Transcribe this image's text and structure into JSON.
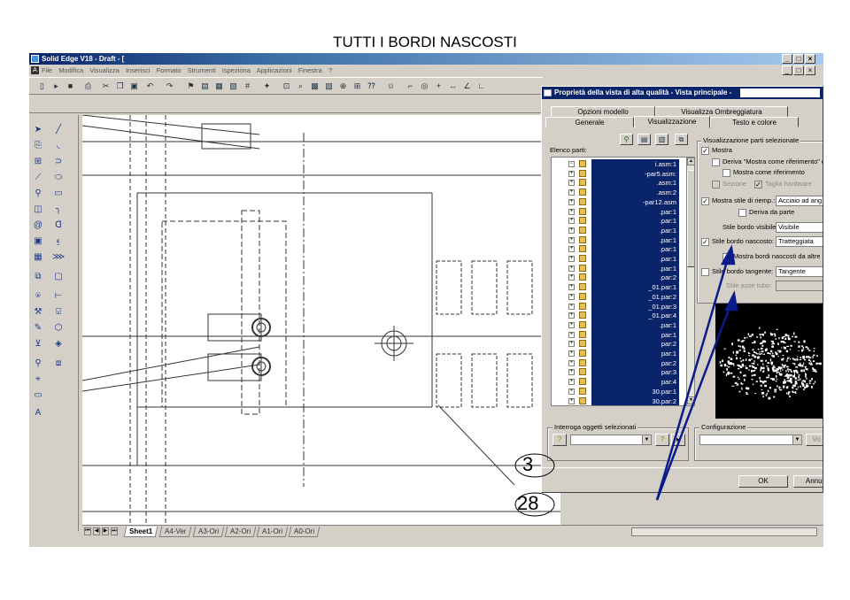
{
  "caption": "TUTTI I BORDI NASCOSTI",
  "app": {
    "title": "Solid Edge V18 - Draft - [",
    "menu": [
      "File",
      "Modifica",
      "Visualizza",
      "Inserisci",
      "Formato",
      "Strumenti",
      "Ispeziona",
      "Applicazioni",
      "Finestra",
      "?"
    ],
    "window_controls": [
      "_",
      "□",
      "×"
    ]
  },
  "sheets": [
    "Sheet1",
    "A4-Ver",
    "A3-Ori",
    "A2-Ori",
    "A1-Ori",
    "A0-Ori"
  ],
  "dialog": {
    "title": "Proprietà della vista di alta qualità - Vista principale -",
    "tabs_top": [
      "Opzioni modello",
      "Visualizza Ombreggiatura"
    ],
    "tabs_bottom": [
      "Generale",
      "Visualizzazione",
      "Testo e colore"
    ],
    "active_tab": "Visualizzazione",
    "parts_label": "Elenco parti:",
    "tree": [
      {
        "sign": "−",
        "name": "i.asm:1"
      },
      {
        "sign": "+",
        "name": "-par5.asm:"
      },
      {
        "sign": "+",
        "name": ".asm:1"
      },
      {
        "sign": "+",
        "name": ".asm:2"
      },
      {
        "sign": "+",
        "name": "-par12.asm"
      },
      {
        "sign": "+",
        "name": ".par:1"
      },
      {
        "sign": "+",
        "name": ".par:1"
      },
      {
        "sign": "+",
        "name": ".par:1"
      },
      {
        "sign": "+",
        "name": ".par:1"
      },
      {
        "sign": "+",
        "name": ".par:1"
      },
      {
        "sign": "+",
        "name": ".par:1"
      },
      {
        "sign": "+",
        "name": ".par:1"
      },
      {
        "sign": "+",
        "name": ".par:2"
      },
      {
        "sign": "+",
        "name": "_01.par:1"
      },
      {
        "sign": "+",
        "name": "_01.par:2"
      },
      {
        "sign": "+",
        "name": "_01.par:3"
      },
      {
        "sign": "+",
        "name": "_01.par:4"
      },
      {
        "sign": "+",
        "name": ".par:1"
      },
      {
        "sign": "+",
        "name": "par:1"
      },
      {
        "sign": "+",
        "name": "par:2"
      },
      {
        "sign": "+",
        "name": "par:1"
      },
      {
        "sign": "+",
        "name": "par:2"
      },
      {
        "sign": "+",
        "name": "par:3"
      },
      {
        "sign": "+",
        "name": "par:4"
      },
      {
        "sign": "+",
        "name": "30.par:1"
      },
      {
        "sign": "+",
        "name": "30.par:2"
      }
    ],
    "group_title": "Visualizzazione parti selezionate",
    "mostra": "Mostra",
    "deriva_riferimento": "Deriva \"Mostra come riferimento\" d",
    "mostra_come_riferimento": "Mostra come riferimento",
    "sezione": "Sezione",
    "taglia_hardware": "Taglia hardware",
    "mostra_stile_riemp": "Mostra stile di riemp.:",
    "stile_riemp_value": "Acciaio ad ang",
    "deriva_da_parte": "Deriva da parte",
    "stile_bordo_visibile": "Stile bordo visibile:",
    "stile_bordo_visibile_value": "Visibile",
    "stile_bordo_nascosto": "Stile bordo nascosto:",
    "stile_bordo_nascosto_value": "Tratteggiata",
    "mostra_bordi_nascosti": "Mostra bordi nascosti da altre p",
    "stile_bordo_tangente": "Stile bordo tangente:",
    "stile_bordo_tangente_value": "Tangente",
    "stile_asse_tubo": "Stile asse tubo:",
    "interroga_label": "Interroga oggetti selezionati",
    "configurazione_label": "Configurazione",
    "ok_label": "OK",
    "annulla_label": "Annull",
    "vo_label": "Vo",
    "help_label": "?"
  },
  "callouts": [
    "3",
    "28"
  ],
  "colors": {
    "selection": "#0a246a",
    "arrow": "#0b1b8a",
    "chrome": "#d4d0c8"
  }
}
